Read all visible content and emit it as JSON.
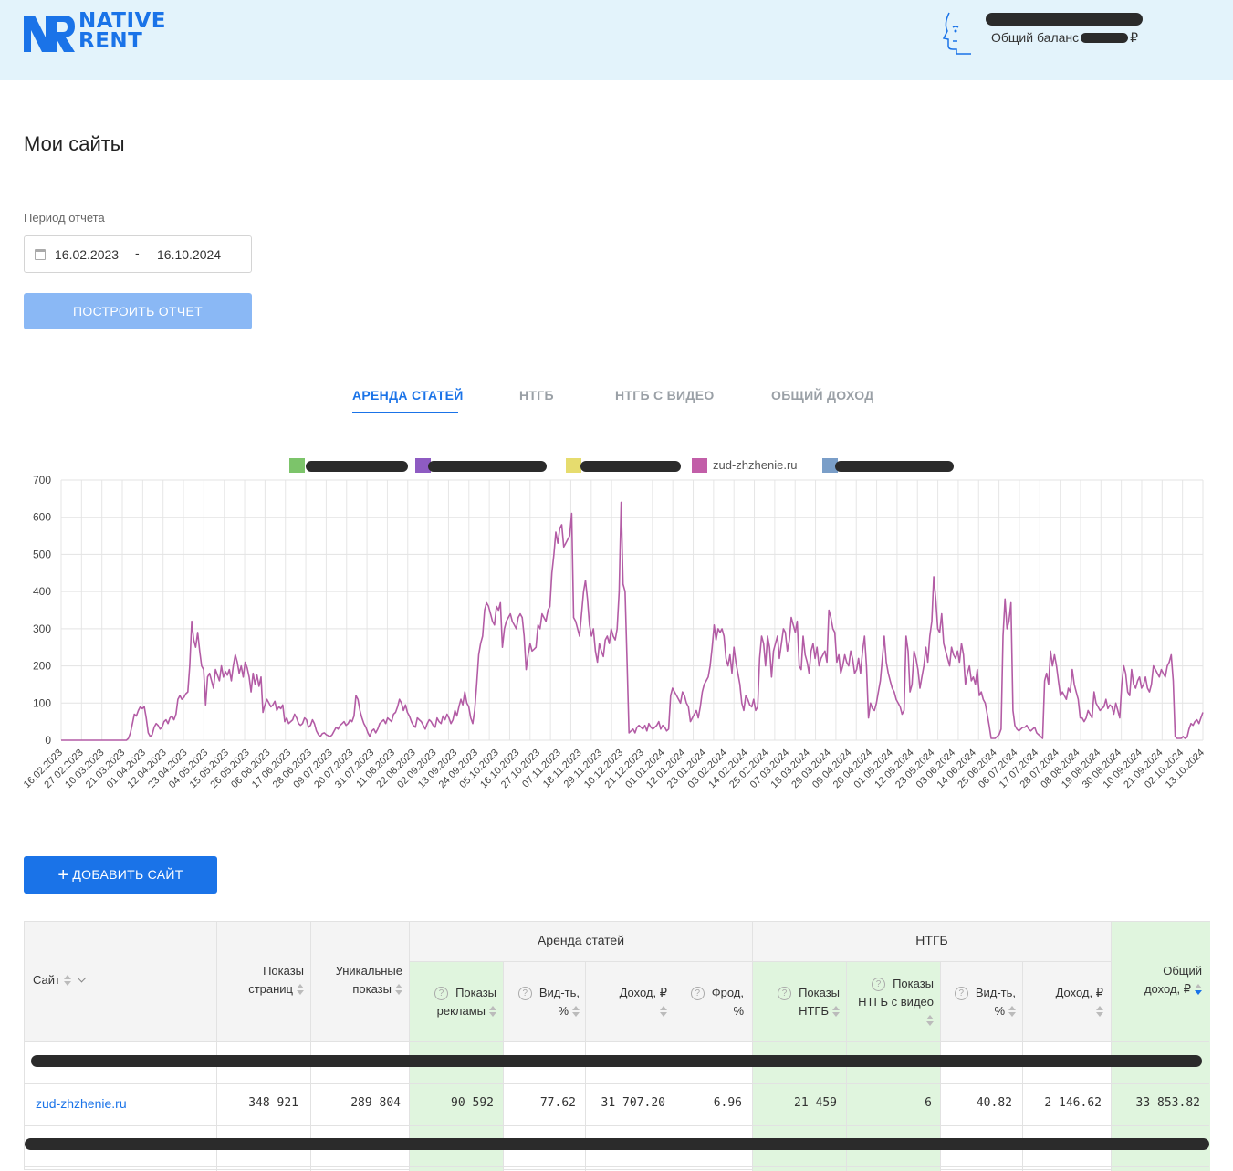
{
  "header": {
    "logo_line1": "NATIVE",
    "logo_line2": "RENT",
    "balance_label": "Общий баланс",
    "currency": "₽"
  },
  "page_title": "Мои сайты",
  "period": {
    "label": "Период отчета",
    "from": "16.02.2023",
    "separator": "-",
    "to": "16.10.2024"
  },
  "build_button": "ПОСТРОИТЬ ОТЧЕТ",
  "tabs": [
    {
      "label": "АРЕНДА СТАТЕЙ",
      "active": true
    },
    {
      "label": "НТГБ",
      "active": false
    },
    {
      "label": "НТГБ С ВИДЕО",
      "active": false
    },
    {
      "label": "ОБЩИЙ ДОХОД",
      "active": false
    }
  ],
  "legend": [
    {
      "label": "",
      "color": "#7cc46a"
    },
    {
      "label": "",
      "color": "#8e5bc2"
    },
    {
      "label": "",
      "color": "#e6dc6e"
    },
    {
      "label": "zud-zhzhenie.ru",
      "color": "#c25ea8"
    },
    {
      "label": "",
      "color": "#7a9ec8"
    }
  ],
  "chart_data": {
    "type": "line",
    "yticks": [
      0,
      100,
      200,
      300,
      400,
      500,
      600,
      700
    ],
    "ylim": [
      0,
      700
    ],
    "x_tick_labels": [
      "16.02.2023",
      "27.02.2023",
      "10.03.2023",
      "21.03.2023",
      "01.04.2023",
      "12.04.2023",
      "23.04.2023",
      "04.05.2023",
      "15.05.2023",
      "26.05.2023",
      "06.06.2023",
      "17.06.2023",
      "28.06.2023",
      "09.07.2023",
      "20.07.2023",
      "31.07.2023",
      "11.08.2023",
      "22.08.2023",
      "02.09.2023",
      "13.09.2023",
      "24.09.2023",
      "05.10.2023",
      "16.10.2023",
      "27.10.2023",
      "07.11.2023",
      "18.11.2023",
      "29.11.2023",
      "10.12.2023",
      "21.12.2023",
      "01.01.2024",
      "12.01.2024",
      "23.01.2024",
      "03.02.2024",
      "14.02.2024",
      "25.02.2024",
      "07.03.2024",
      "18.03.2024",
      "29.03.2024",
      "09.04.2024",
      "20.04.2024",
      "01.05.2024",
      "12.05.2024",
      "23.05.2024",
      "03.06.2024",
      "14.06.2024",
      "25.06.2024",
      "06.07.2024",
      "17.07.2024",
      "28.07.2024",
      "08.08.2024",
      "19.08.2024",
      "30.08.2024",
      "10.09.2024",
      "21.09.2024",
      "02.10.2024",
      "13.10.2024"
    ],
    "series": [
      {
        "name": "zud-zhzhenie.ru",
        "color": "#b35ca5",
        "values": [
          0,
          0,
          0,
          0,
          0,
          0,
          0,
          0,
          0,
          0,
          0,
          0,
          0,
          0,
          0,
          0,
          0,
          0,
          0,
          0,
          0,
          0,
          0,
          0,
          0,
          0,
          0,
          0,
          0,
          0,
          0,
          0,
          0,
          0,
          5,
          20,
          45,
          70,
          65,
          80,
          90,
          85,
          90,
          60,
          20,
          10,
          15,
          35,
          45,
          40,
          30,
          35,
          50,
          55,
          45,
          60,
          65,
          55,
          70,
          110,
          120,
          110,
          115,
          125,
          130,
          200,
          320,
          270,
          250,
          290,
          240,
          200,
          190,
          95,
          170,
          180,
          160,
          140,
          190,
          175,
          160,
          200,
          170,
          185,
          175,
          190,
          160,
          200,
          230,
          210,
          180,
          200,
          170,
          210,
          195,
          170,
          130,
          180,
          150,
          175,
          145,
          170,
          75,
          95,
          110,
          100,
          90,
          95,
          105,
          80,
          90,
          85,
          95,
          50,
          60,
          45,
          50,
          55,
          70,
          60,
          45,
          40,
          45,
          60,
          55,
          35,
          40,
          55,
          45,
          25,
          15,
          10,
          18,
          20,
          15,
          12,
          10,
          15,
          25,
          35,
          30,
          40,
          45,
          50,
          40,
          45,
          55,
          50,
          65,
          120,
          110,
          80,
          60,
          45,
          35,
          20,
          10,
          25,
          30,
          20,
          30,
          45,
          50,
          55,
          45,
          60,
          55,
          50,
          70,
          75,
          90,
          110,
          100,
          80,
          95,
          75,
          65,
          50,
          40,
          35,
          60,
          55,
          50,
          40,
          30,
          45,
          55,
          50,
          40,
          35,
          60,
          50,
          45,
          65,
          55,
          70,
          60,
          45,
          55,
          80,
          65,
          90,
          110,
          95,
          130,
          100,
          90,
          60,
          45,
          80,
          150,
          230,
          260,
          280,
          350,
          370,
          360,
          340,
          320,
          310,
          360,
          350,
          370,
          250,
          300,
          320,
          330,
          340,
          320,
          310,
          300,
          330,
          340,
          330,
          280,
          190,
          230,
          260,
          240,
          245,
          250,
          310,
          300,
          340,
          330,
          320,
          350,
          360,
          450,
          500,
          560,
          530,
          570,
          580,
          520,
          530,
          540,
          550,
          610,
          330,
          320,
          300,
          280,
          340,
          400,
          430,
          380,
          310,
          280,
          300,
          240,
          210,
          260,
          240,
          225,
          270,
          280,
          260,
          300,
          280,
          270,
          300,
          400,
          640,
          420,
          400,
          210,
          20,
          25,
          30,
          20,
          35,
          40,
          35,
          30,
          40,
          25,
          45,
          35,
          30,
          35,
          40,
          50,
          30,
          40,
          35,
          25,
          30,
          120,
          140,
          130,
          120,
          110,
          100,
          130,
          120,
          100,
          90,
          50,
          60,
          70,
          80,
          60,
          90,
          130,
          150,
          160,
          170,
          200,
          250,
          310,
          270,
          300,
          290,
          300,
          280,
          220,
          200,
          230,
          180,
          250,
          210,
          180,
          150,
          100,
          80,
          120,
          110,
          95,
          90,
          110,
          80,
          90,
          220,
          280,
          260,
          200,
          280,
          250,
          170,
          240,
          260,
          280,
          220,
          260,
          300,
          290,
          240,
          270,
          330,
          310,
          290,
          320,
          200,
          190,
          280,
          230,
          210,
          180,
          240,
          260,
          220,
          250,
          200,
          220,
          230,
          240,
          210,
          350,
          330,
          300,
          290,
          210,
          230,
          180,
          200,
          230,
          210,
          200,
          240,
          220,
          180,
          190,
          220,
          180,
          240,
          280,
          200,
          60,
          100,
          85,
          80,
          100,
          130,
          160,
          220,
          280,
          210,
          180,
          160,
          140,
          130,
          110,
          100,
          90,
          70,
          80,
          280,
          240,
          130,
          150,
          240,
          220,
          190,
          140,
          170,
          200,
          250,
          210,
          280,
          320,
          440,
          380,
          300,
          290,
          340,
          260,
          240,
          220,
          200,
          250,
          230,
          220,
          240,
          210,
          260,
          230,
          150,
          180,
          200,
          160,
          170,
          150,
          190,
          120,
          130,
          110,
          100,
          70,
          40,
          5,
          5,
          5,
          10,
          15,
          30,
          280,
          380,
          300,
          320,
          370,
          80,
          40,
          30,
          25,
          30,
          35,
          35,
          40,
          30,
          25,
          30,
          35,
          20,
          15,
          10,
          5,
          160,
          180,
          150,
          240,
          200,
          230,
          200,
          160,
          120,
          130,
          120,
          110,
          140,
          130,
          190,
          150,
          130,
          110,
          60,
          60,
          50,
          60,
          80,
          70,
          60,
          130,
          100,
          90,
          80,
          85,
          90,
          110,
          85,
          95,
          90,
          70,
          100,
          80,
          60,
          150,
          200,
          180,
          130,
          120,
          190,
          150,
          140,
          160,
          170,
          140,
          150,
          170,
          140,
          130,
          150,
          200,
          190,
          180,
          170,
          190,
          180,
          170,
          200,
          210,
          230,
          160,
          10,
          5,
          5,
          5,
          10,
          5,
          8,
          30,
          45,
          40,
          50,
          55,
          45,
          60,
          75
        ]
      }
    ]
  },
  "add_site_button": "ДОБАВИТЬ САЙТ",
  "table": {
    "col_site": "Сайт",
    "col_page_views": "Показы страниц",
    "col_unique": "Уникальные показы",
    "group_rent": "Аренда статей",
    "group_ntgb": "НТГБ",
    "col_ad_shows": "Показы рекламы",
    "col_visibility": "Вид-ть, %",
    "col_income": "Доход, ₽",
    "col_fraud": "Фрод, %",
    "col_ntgb_shows": "Показы НТГБ",
    "col_ntgb_video": "Показы НТГБ с видео",
    "col_ntgb_visibility": "Вид-ть, %",
    "col_ntgb_income": "Доход, ₽",
    "col_total_income": "Общий доход, ₽",
    "row": {
      "site": "zud-zhzhenie.ru",
      "page_views": "348 921",
      "unique": "289 804",
      "ad_shows": "90 592",
      "visibility": "77.62",
      "income": "31 707.20",
      "fraud": "6.96",
      "ntgb_shows": "21 459",
      "ntgb_video": "6",
      "ntgb_visibility": "40.82",
      "ntgb_income": "2 146.62",
      "total": "33 853.82"
    }
  }
}
